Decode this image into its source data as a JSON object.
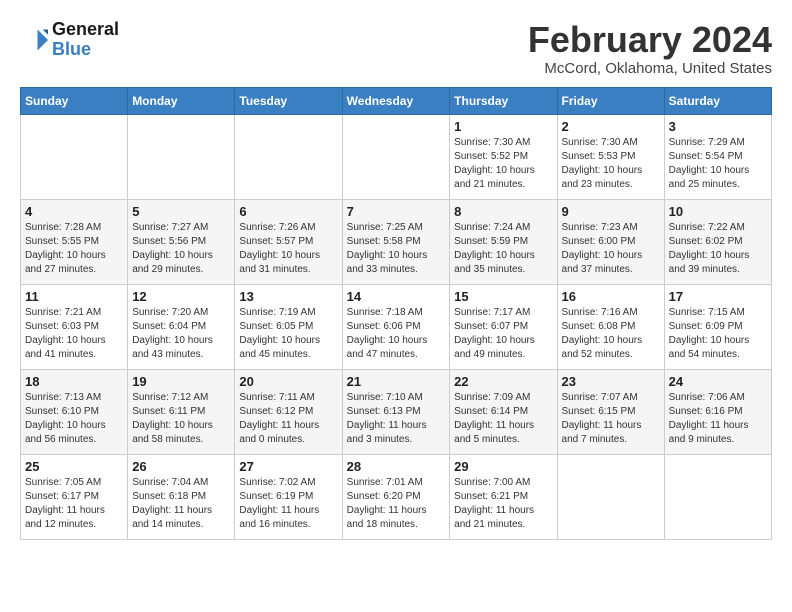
{
  "header": {
    "logo_line1": "General",
    "logo_line2": "Blue",
    "month": "February 2024",
    "location": "McCord, Oklahoma, United States"
  },
  "weekdays": [
    "Sunday",
    "Monday",
    "Tuesday",
    "Wednesday",
    "Thursday",
    "Friday",
    "Saturday"
  ],
  "weeks": [
    [
      {
        "day": "",
        "info": ""
      },
      {
        "day": "",
        "info": ""
      },
      {
        "day": "",
        "info": ""
      },
      {
        "day": "",
        "info": ""
      },
      {
        "day": "1",
        "info": "Sunrise: 7:30 AM\nSunset: 5:52 PM\nDaylight: 10 hours\nand 21 minutes."
      },
      {
        "day": "2",
        "info": "Sunrise: 7:30 AM\nSunset: 5:53 PM\nDaylight: 10 hours\nand 23 minutes."
      },
      {
        "day": "3",
        "info": "Sunrise: 7:29 AM\nSunset: 5:54 PM\nDaylight: 10 hours\nand 25 minutes."
      }
    ],
    [
      {
        "day": "4",
        "info": "Sunrise: 7:28 AM\nSunset: 5:55 PM\nDaylight: 10 hours\nand 27 minutes."
      },
      {
        "day": "5",
        "info": "Sunrise: 7:27 AM\nSunset: 5:56 PM\nDaylight: 10 hours\nand 29 minutes."
      },
      {
        "day": "6",
        "info": "Sunrise: 7:26 AM\nSunset: 5:57 PM\nDaylight: 10 hours\nand 31 minutes."
      },
      {
        "day": "7",
        "info": "Sunrise: 7:25 AM\nSunset: 5:58 PM\nDaylight: 10 hours\nand 33 minutes."
      },
      {
        "day": "8",
        "info": "Sunrise: 7:24 AM\nSunset: 5:59 PM\nDaylight: 10 hours\nand 35 minutes."
      },
      {
        "day": "9",
        "info": "Sunrise: 7:23 AM\nSunset: 6:00 PM\nDaylight: 10 hours\nand 37 minutes."
      },
      {
        "day": "10",
        "info": "Sunrise: 7:22 AM\nSunset: 6:02 PM\nDaylight: 10 hours\nand 39 minutes."
      }
    ],
    [
      {
        "day": "11",
        "info": "Sunrise: 7:21 AM\nSunset: 6:03 PM\nDaylight: 10 hours\nand 41 minutes."
      },
      {
        "day": "12",
        "info": "Sunrise: 7:20 AM\nSunset: 6:04 PM\nDaylight: 10 hours\nand 43 minutes."
      },
      {
        "day": "13",
        "info": "Sunrise: 7:19 AM\nSunset: 6:05 PM\nDaylight: 10 hours\nand 45 minutes."
      },
      {
        "day": "14",
        "info": "Sunrise: 7:18 AM\nSunset: 6:06 PM\nDaylight: 10 hours\nand 47 minutes."
      },
      {
        "day": "15",
        "info": "Sunrise: 7:17 AM\nSunset: 6:07 PM\nDaylight: 10 hours\nand 49 minutes."
      },
      {
        "day": "16",
        "info": "Sunrise: 7:16 AM\nSunset: 6:08 PM\nDaylight: 10 hours\nand 52 minutes."
      },
      {
        "day": "17",
        "info": "Sunrise: 7:15 AM\nSunset: 6:09 PM\nDaylight: 10 hours\nand 54 minutes."
      }
    ],
    [
      {
        "day": "18",
        "info": "Sunrise: 7:13 AM\nSunset: 6:10 PM\nDaylight: 10 hours\nand 56 minutes."
      },
      {
        "day": "19",
        "info": "Sunrise: 7:12 AM\nSunset: 6:11 PM\nDaylight: 10 hours\nand 58 minutes."
      },
      {
        "day": "20",
        "info": "Sunrise: 7:11 AM\nSunset: 6:12 PM\nDaylight: 11 hours\nand 0 minutes."
      },
      {
        "day": "21",
        "info": "Sunrise: 7:10 AM\nSunset: 6:13 PM\nDaylight: 11 hours\nand 3 minutes."
      },
      {
        "day": "22",
        "info": "Sunrise: 7:09 AM\nSunset: 6:14 PM\nDaylight: 11 hours\nand 5 minutes."
      },
      {
        "day": "23",
        "info": "Sunrise: 7:07 AM\nSunset: 6:15 PM\nDaylight: 11 hours\nand 7 minutes."
      },
      {
        "day": "24",
        "info": "Sunrise: 7:06 AM\nSunset: 6:16 PM\nDaylight: 11 hours\nand 9 minutes."
      }
    ],
    [
      {
        "day": "25",
        "info": "Sunrise: 7:05 AM\nSunset: 6:17 PM\nDaylight: 11 hours\nand 12 minutes."
      },
      {
        "day": "26",
        "info": "Sunrise: 7:04 AM\nSunset: 6:18 PM\nDaylight: 11 hours\nand 14 minutes."
      },
      {
        "day": "27",
        "info": "Sunrise: 7:02 AM\nSunset: 6:19 PM\nDaylight: 11 hours\nand 16 minutes."
      },
      {
        "day": "28",
        "info": "Sunrise: 7:01 AM\nSunset: 6:20 PM\nDaylight: 11 hours\nand 18 minutes."
      },
      {
        "day": "29",
        "info": "Sunrise: 7:00 AM\nSunset: 6:21 PM\nDaylight: 11 hours\nand 21 minutes."
      },
      {
        "day": "",
        "info": ""
      },
      {
        "day": "",
        "info": ""
      }
    ]
  ]
}
